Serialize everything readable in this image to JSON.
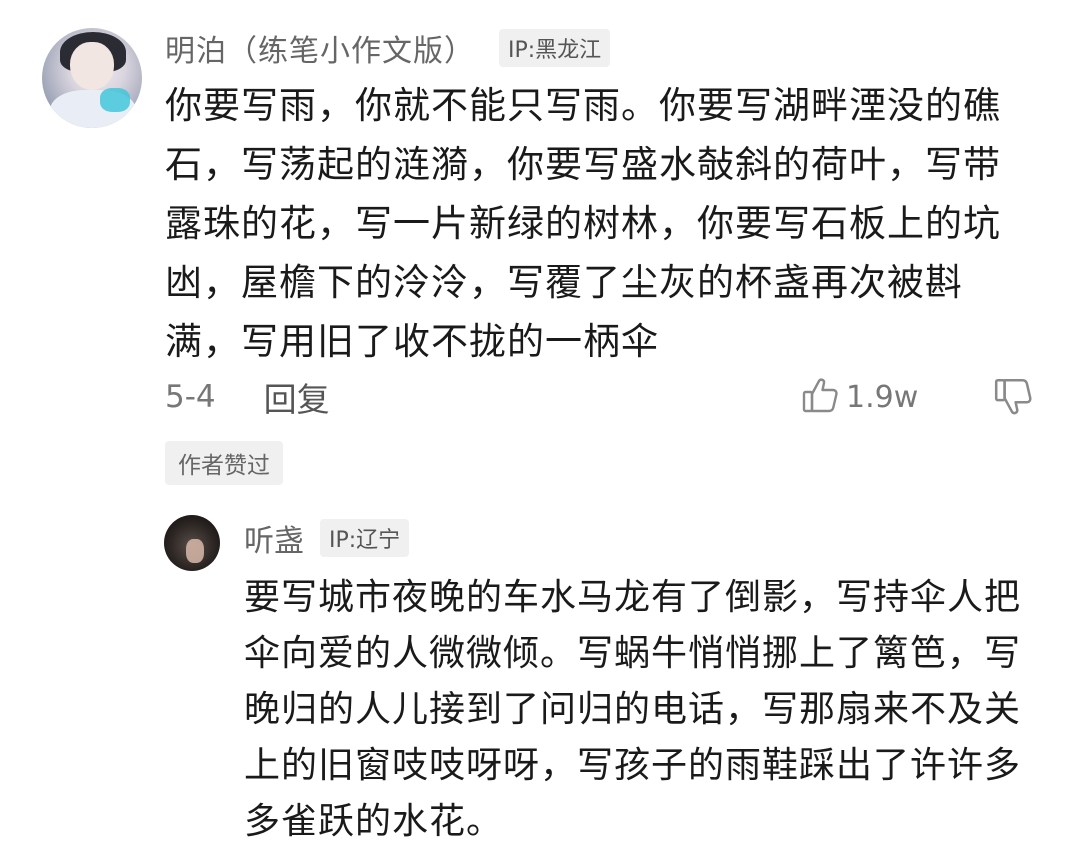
{
  "comment": {
    "username": "明泊（练笔小作文版）",
    "ip": "IP:黑龙江",
    "text": "你要写雨，你就不能只写雨。你要写湖畔湮没的礁石，写荡起的涟漪，你要写盛水敧斜的荷叶，写带露珠的花，写一片新绿的树林，你要写石板上的坑凼，屋檐下的泠泠，写覆了尘灰的杯盏再次被斟满，写用旧了收不拢的一柄伞",
    "date": "5-4",
    "reply_label": "回复",
    "like_count": "1.9w",
    "author_liked": "作者赞过",
    "icons": {
      "like": "thumbs-up-icon",
      "dislike": "thumbs-down-icon"
    }
  },
  "reply": {
    "username": "听盏",
    "ip": "IP:辽宁",
    "text": "要写城市夜晚的车水马龙有了倒影，写持伞人把伞向爱的人微微倾。写蜗牛悄悄挪上了篱笆，写晚归的人儿接到了问归的电话，写那扇来不及关上的旧窗吱吱呀呀，写孩子的雨鞋踩出了许许多多雀跃的水花。"
  }
}
